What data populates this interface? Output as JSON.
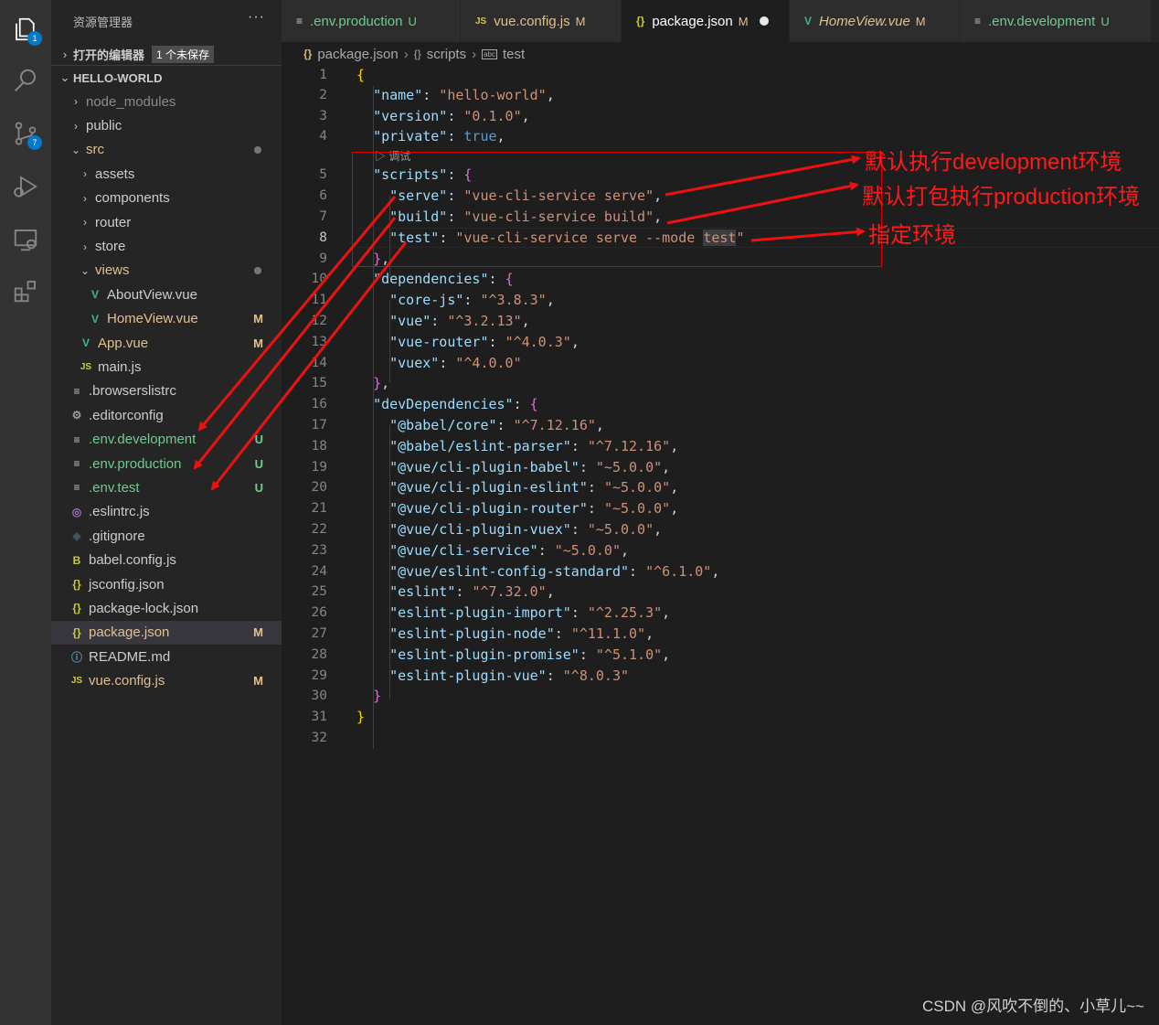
{
  "activity_bar": {
    "explorer_badge": "1",
    "scm_badge": "7"
  },
  "sidebar": {
    "title": "资源管理器",
    "more": "···",
    "open_editors_label": "打开的编辑器",
    "unsaved_label": "1 个未保存",
    "project_label": "HELLO-WORLD",
    "tree": [
      {
        "label": "node_modules",
        "kind": "folder-closed",
        "depth": 0,
        "color": "dim"
      },
      {
        "label": "public",
        "kind": "folder-closed",
        "depth": 0,
        "color": "plain"
      },
      {
        "label": "src",
        "kind": "folder-open",
        "depth": 0,
        "color": "mod",
        "dot": true
      },
      {
        "label": "assets",
        "kind": "folder-closed",
        "depth": 1,
        "color": "plain"
      },
      {
        "label": "components",
        "kind": "folder-closed",
        "depth": 1,
        "color": "plain"
      },
      {
        "label": "router",
        "kind": "folder-closed",
        "depth": 1,
        "color": "plain"
      },
      {
        "label": "store",
        "kind": "folder-closed",
        "depth": 1,
        "color": "plain"
      },
      {
        "label": "views",
        "kind": "folder-open",
        "depth": 1,
        "color": "mod",
        "dot": true
      },
      {
        "label": "AboutView.vue",
        "kind": "vue",
        "depth": 2,
        "color": "plain"
      },
      {
        "label": "HomeView.vue",
        "kind": "vue",
        "depth": 2,
        "color": "mod",
        "status": "M"
      },
      {
        "label": "App.vue",
        "kind": "vue",
        "depth": 1,
        "color": "mod",
        "status": "M"
      },
      {
        "label": "main.js",
        "kind": "js",
        "depth": 1,
        "color": "plain"
      },
      {
        "label": ".browserslistrc",
        "kind": "lines",
        "depth": 0,
        "color": "plain"
      },
      {
        "label": ".editorconfig",
        "kind": "gear",
        "depth": 0,
        "color": "plain"
      },
      {
        "label": ".env.development",
        "kind": "lines",
        "depth": 0,
        "color": "new",
        "status": "U"
      },
      {
        "label": ".env.production",
        "kind": "lines",
        "depth": 0,
        "color": "new",
        "status": "U"
      },
      {
        "label": ".env.test",
        "kind": "lines",
        "depth": 0,
        "color": "new",
        "status": "U"
      },
      {
        "label": ".eslintrc.js",
        "kind": "eslint",
        "depth": 0,
        "color": "plain"
      },
      {
        "label": ".gitignore",
        "kind": "git",
        "depth": 0,
        "color": "plain"
      },
      {
        "label": "babel.config.js",
        "kind": "babel",
        "depth": 0,
        "color": "plain"
      },
      {
        "label": "jsconfig.json",
        "kind": "json",
        "depth": 0,
        "color": "plain"
      },
      {
        "label": "package-lock.json",
        "kind": "json",
        "depth": 0,
        "color": "plain"
      },
      {
        "label": "package.json",
        "kind": "json",
        "depth": 0,
        "color": "mod",
        "status": "M",
        "selected": true
      },
      {
        "label": "README.md",
        "kind": "info",
        "depth": 0,
        "color": "plain"
      },
      {
        "label": "vue.config.js",
        "kind": "js",
        "depth": 0,
        "color": "mod",
        "status": "M"
      }
    ]
  },
  "tabs": [
    {
      "label": ".env.production",
      "status": "U",
      "kind": "lines",
      "color": "new"
    },
    {
      "label": "vue.config.js",
      "status": "M",
      "kind": "js",
      "color": "mod"
    },
    {
      "label": "package.json",
      "status": "M",
      "kind": "json",
      "color": "mod",
      "active": true,
      "unsaved_dot": true
    },
    {
      "label": "HomeView.vue",
      "status": "M",
      "kind": "vue",
      "color": "mod",
      "italic": true
    },
    {
      "label": ".env.development",
      "status": "U",
      "kind": "lines",
      "color": "new"
    }
  ],
  "breadcrumb": {
    "file": "package.json",
    "section": "scripts",
    "item": "test"
  },
  "editor": {
    "codelens": "▷ 调试",
    "current_line": 8,
    "lines": [
      [
        [
          "br1",
          "{"
        ]
      ],
      [
        [
          "p",
          "  "
        ],
        [
          "k",
          "\"name\""
        ],
        [
          "p",
          ": "
        ],
        [
          "s",
          "\"hello-world\""
        ],
        [
          "p",
          ","
        ]
      ],
      [
        [
          "p",
          "  "
        ],
        [
          "k",
          "\"version\""
        ],
        [
          "p",
          ": "
        ],
        [
          "s",
          "\"0.1.0\""
        ],
        [
          "p",
          ","
        ]
      ],
      [
        [
          "p",
          "  "
        ],
        [
          "k",
          "\"private\""
        ],
        [
          "p",
          ": "
        ],
        [
          "b",
          "true"
        ],
        [
          "p",
          ","
        ]
      ],
      [
        [
          "p",
          "  "
        ],
        [
          "k",
          "\"scripts\""
        ],
        [
          "p",
          ": "
        ],
        [
          "br2",
          "{"
        ]
      ],
      [
        [
          "p",
          "    "
        ],
        [
          "k",
          "\"serve\""
        ],
        [
          "p",
          ": "
        ],
        [
          "s",
          "\"vue-cli-service serve\""
        ],
        [
          "p",
          ","
        ]
      ],
      [
        [
          "p",
          "    "
        ],
        [
          "k",
          "\"build\""
        ],
        [
          "p",
          ": "
        ],
        [
          "s",
          "\"vue-cli-service build\""
        ],
        [
          "p",
          ","
        ]
      ],
      [
        [
          "p",
          "    "
        ],
        [
          "k",
          "\"test\""
        ],
        [
          "p",
          ": "
        ],
        [
          "s",
          "\"vue-cli-service serve --mode "
        ],
        [
          "s hl",
          "test"
        ],
        [
          "s",
          "\""
        ]
      ],
      [
        [
          "p",
          "  "
        ],
        [
          "br2",
          "}"
        ],
        [
          "p",
          ","
        ]
      ],
      [
        [
          "p",
          "  "
        ],
        [
          "k",
          "\"dependencies\""
        ],
        [
          "p",
          ": "
        ],
        [
          "br2",
          "{"
        ]
      ],
      [
        [
          "p",
          "    "
        ],
        [
          "k",
          "\"core-js\""
        ],
        [
          "p",
          ": "
        ],
        [
          "s",
          "\"^3.8.3\""
        ],
        [
          "p",
          ","
        ]
      ],
      [
        [
          "p",
          "    "
        ],
        [
          "k",
          "\"vue\""
        ],
        [
          "p",
          ": "
        ],
        [
          "s",
          "\"^3.2.13\""
        ],
        [
          "p",
          ","
        ]
      ],
      [
        [
          "p",
          "    "
        ],
        [
          "k",
          "\"vue-router\""
        ],
        [
          "p",
          ": "
        ],
        [
          "s",
          "\"^4.0.3\""
        ],
        [
          "p",
          ","
        ]
      ],
      [
        [
          "p",
          "    "
        ],
        [
          "k",
          "\"vuex\""
        ],
        [
          "p",
          ": "
        ],
        [
          "s",
          "\"^4.0.0\""
        ]
      ],
      [
        [
          "p",
          "  "
        ],
        [
          "br2",
          "}"
        ],
        [
          "p",
          ","
        ]
      ],
      [
        [
          "p",
          "  "
        ],
        [
          "k",
          "\"devDependencies\""
        ],
        [
          "p",
          ": "
        ],
        [
          "br2",
          "{"
        ]
      ],
      [
        [
          "p",
          "    "
        ],
        [
          "k",
          "\"@babel/core\""
        ],
        [
          "p",
          ": "
        ],
        [
          "s",
          "\"^7.12.16\""
        ],
        [
          "p",
          ","
        ]
      ],
      [
        [
          "p",
          "    "
        ],
        [
          "k",
          "\"@babel/eslint-parser\""
        ],
        [
          "p",
          ": "
        ],
        [
          "s",
          "\"^7.12.16\""
        ],
        [
          "p",
          ","
        ]
      ],
      [
        [
          "p",
          "    "
        ],
        [
          "k",
          "\"@vue/cli-plugin-babel\""
        ],
        [
          "p",
          ": "
        ],
        [
          "s",
          "\"~5.0.0\""
        ],
        [
          "p",
          ","
        ]
      ],
      [
        [
          "p",
          "    "
        ],
        [
          "k",
          "\"@vue/cli-plugin-eslint\""
        ],
        [
          "p",
          ": "
        ],
        [
          "s",
          "\"~5.0.0\""
        ],
        [
          "p",
          ","
        ]
      ],
      [
        [
          "p",
          "    "
        ],
        [
          "k",
          "\"@vue/cli-plugin-router\""
        ],
        [
          "p",
          ": "
        ],
        [
          "s",
          "\"~5.0.0\""
        ],
        [
          "p",
          ","
        ]
      ],
      [
        [
          "p",
          "    "
        ],
        [
          "k",
          "\"@vue/cli-plugin-vuex\""
        ],
        [
          "p",
          ": "
        ],
        [
          "s",
          "\"~5.0.0\""
        ],
        [
          "p",
          ","
        ]
      ],
      [
        [
          "p",
          "    "
        ],
        [
          "k",
          "\"@vue/cli-service\""
        ],
        [
          "p",
          ": "
        ],
        [
          "s",
          "\"~5.0.0\""
        ],
        [
          "p",
          ","
        ]
      ],
      [
        [
          "p",
          "    "
        ],
        [
          "k",
          "\"@vue/eslint-config-standard\""
        ],
        [
          "p",
          ": "
        ],
        [
          "s",
          "\"^6.1.0\""
        ],
        [
          "p",
          ","
        ]
      ],
      [
        [
          "p",
          "    "
        ],
        [
          "k",
          "\"eslint\""
        ],
        [
          "p",
          ": "
        ],
        [
          "s",
          "\"^7.32.0\""
        ],
        [
          "p",
          ","
        ]
      ],
      [
        [
          "p",
          "    "
        ],
        [
          "k",
          "\"eslint-plugin-import\""
        ],
        [
          "p",
          ": "
        ],
        [
          "s",
          "\"^2.25.3\""
        ],
        [
          "p",
          ","
        ]
      ],
      [
        [
          "p",
          "    "
        ],
        [
          "k",
          "\"eslint-plugin-node\""
        ],
        [
          "p",
          ": "
        ],
        [
          "s",
          "\"^11.1.0\""
        ],
        [
          "p",
          ","
        ]
      ],
      [
        [
          "p",
          "    "
        ],
        [
          "k",
          "\"eslint-plugin-promise\""
        ],
        [
          "p",
          ": "
        ],
        [
          "s",
          "\"^5.1.0\""
        ],
        [
          "p",
          ","
        ]
      ],
      [
        [
          "p",
          "    "
        ],
        [
          "k",
          "\"eslint-plugin-vue\""
        ],
        [
          "p",
          ": "
        ],
        [
          "s",
          "\"^8.0.3\""
        ]
      ],
      [
        [
          "p",
          "  "
        ],
        [
          "br2",
          "}"
        ]
      ],
      [
        [
          "br1",
          "}"
        ]
      ],
      [
        [
          "p",
          ""
        ]
      ]
    ]
  },
  "annotations": {
    "serve_note": "默认执行development环境",
    "build_note": "默认打包执行production环境",
    "test_note": "指定环境"
  },
  "colors": {
    "annotation": "#ff1a1a",
    "modified": "#e2c08d",
    "untracked": "#73c991",
    "accent": "#007acc"
  },
  "watermark": "CSDN @风吹不倒的、小草儿~~"
}
